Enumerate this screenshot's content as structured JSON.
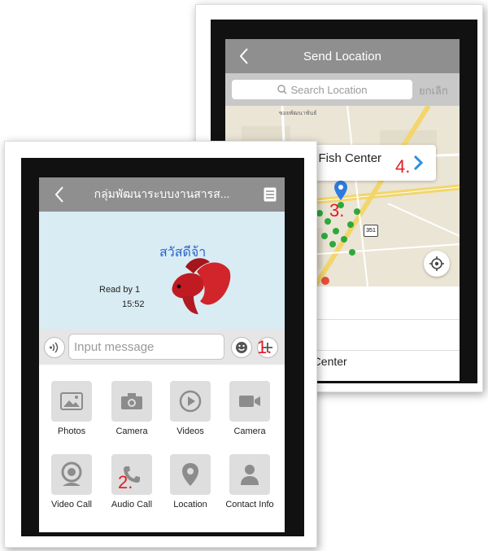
{
  "location_screen": {
    "title": "Send Location",
    "search_placeholder": "Search Location",
    "cancel_label": "ยกเลิก",
    "map_label": "ซอยพัฒนาพันธ์",
    "highway_badge": "351",
    "pin_title": "er Fish Center",
    "list_item": "h Center",
    "step3_marker": "3.",
    "step4_marker": "4."
  },
  "chat_screen": {
    "title": "กลุ่มพัฒนาระบบงานสารส...",
    "greeting_text": "สวัสดีจ้า",
    "read_receipt": "Read by 1",
    "time": "15:52",
    "input_placeholder": "Input message",
    "step1_marker": "1.",
    "step2_marker": "2.",
    "attachments": [
      {
        "label": "Photos",
        "icon": "photos-icon"
      },
      {
        "label": "Camera",
        "icon": "camera-icon"
      },
      {
        "label": "Videos",
        "icon": "play-icon"
      },
      {
        "label": "Camera",
        "icon": "video-camera-icon"
      },
      {
        "label": "Video Call",
        "icon": "webcam-icon"
      },
      {
        "label": "Audio Call",
        "icon": "phone-icon"
      },
      {
        "label": "Location",
        "icon": "location-pin-icon"
      },
      {
        "label": "Contact Info",
        "icon": "person-icon"
      }
    ]
  },
  "colors": {
    "nav_bar": "#8f8f8f",
    "chat_background": "#d9ecf4",
    "marker_red": "#e31b23",
    "tile_bg": "#dedede",
    "icon_grey": "#8c8c8c",
    "map_pin_blue": "#2d7be0"
  }
}
